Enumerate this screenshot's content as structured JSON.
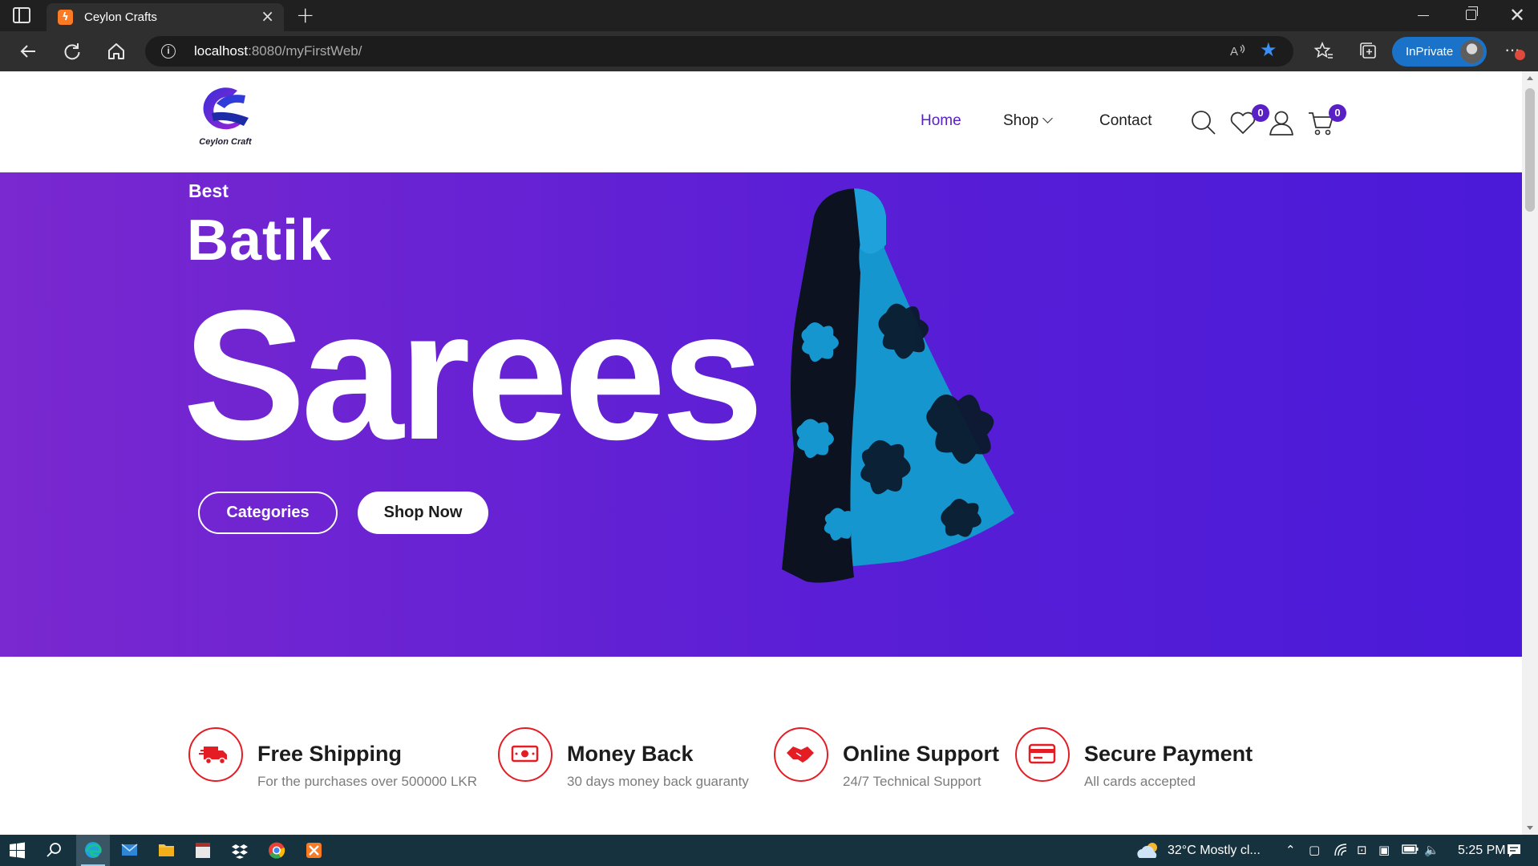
{
  "browser": {
    "tab_title": "Ceylon Crafts",
    "tab_favicon_glyph": "ZZ",
    "address_host": "localhost",
    "address_path": ":8080/myFirstWeb/",
    "read_aloud_label": "Á",
    "inprivate_label": "InPrivate",
    "more_label": "···",
    "accent_color": "#1a73c9"
  },
  "site": {
    "logo_text": "Ceylon Craft",
    "brand_color": "#5a20c8",
    "nav": {
      "home": "Home",
      "shop": "Shop",
      "contact": "Contact"
    },
    "wishlist_count": "0",
    "cart_count": "0"
  },
  "hero": {
    "kicker": "Best",
    "title": "Batik",
    "big_word": "Sarees",
    "primary_button": "Categories",
    "secondary_button": "Shop Now",
    "background_start": "#7a28cf",
    "background_end": "#4a1ad8"
  },
  "features": [
    {
      "icon": "truck-icon",
      "title": "Free Shipping",
      "subtitle": "For the purchases over 500000 LKR"
    },
    {
      "icon": "money-icon",
      "title": "Money Back",
      "subtitle": "30 days money back guaranty"
    },
    {
      "icon": "handshake-icon",
      "title": "Online Support",
      "subtitle": "24/7 Technical Support"
    },
    {
      "icon": "credit-card-icon",
      "title": "Secure Payment",
      "subtitle": "All cards accepted"
    }
  ],
  "feature_icon_color": "#e41c24",
  "taskbar": {
    "weather": "32°C  Mostly cl...",
    "time": "5:25 PM"
  }
}
